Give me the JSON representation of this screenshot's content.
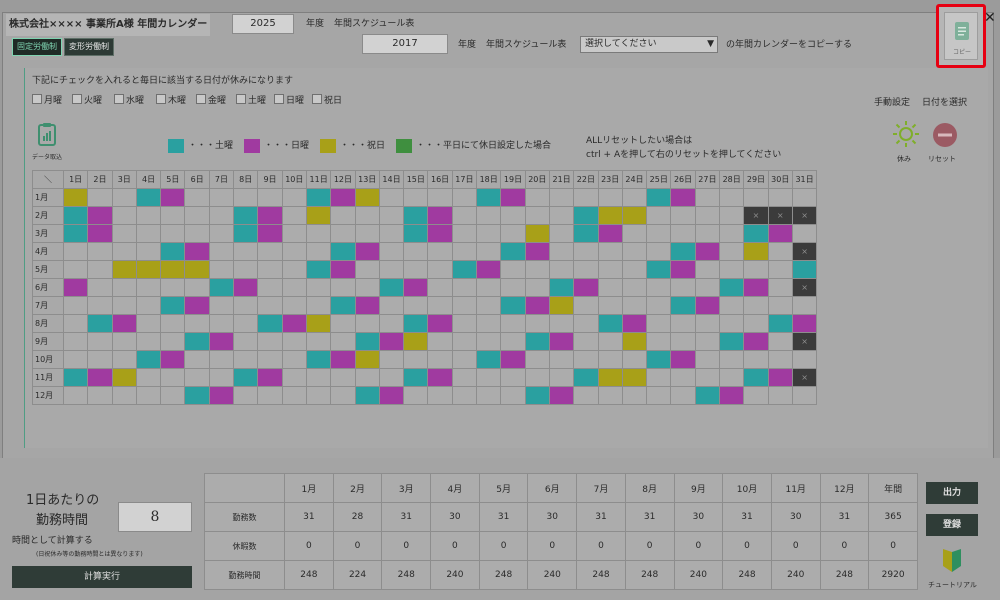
{
  "header": {
    "title": "株式会社×××× 事業所A様 年間カレンダー",
    "year1": "2025",
    "year_label1": "年度",
    "schedule_label1": "年間スケジュール表",
    "year2": "2017",
    "year_label2": "年度",
    "schedule_label2": "年間スケジュール表",
    "select_value": "選択してください",
    "copy_suffix": "の年間カレンダーをコピーする",
    "copy_button_label": "コピー"
  },
  "mode_tabs": [
    "固定労働制",
    "変形労働制"
  ],
  "weekday_instruction": "下記にチェックを入れると毎日に該当する日付が休みになります",
  "weekday_checks": [
    "月曜",
    "火曜",
    "水曜",
    "木曜",
    "金曜",
    "土曜",
    "日曜",
    "祝日"
  ],
  "manual": {
    "manual_setting": "手動設定",
    "select_date": "日付を選択",
    "holiday": "休み",
    "reset": "リセット"
  },
  "data_import": "データ取込",
  "legend": [
    {
      "label": "・・・土曜",
      "color": "#2aa0a0"
    },
    {
      "label": "・・・日曜",
      "color": "#a03aa0"
    },
    {
      "label": "・・・祝日",
      "color": "#a8a018"
    },
    {
      "label": "・・・平日にて休日設定した場合",
      "color": "#3f8f3f"
    }
  ],
  "reset_note": {
    "line1": "ALLリセットしたい場合は",
    "line2": "ctrl + Aを押して右のリセットを押してください"
  },
  "calendar": {
    "corner": "＼",
    "days": [
      "1日",
      "2日",
      "3日",
      "4日",
      "5日",
      "6日",
      "7日",
      "8日",
      "9日",
      "10日",
      "11日",
      "12日",
      "13日",
      "14日",
      "15日",
      "16日",
      "17日",
      "18日",
      "19日",
      "20日",
      "21日",
      "22日",
      "23日",
      "24日",
      "25日",
      "26日",
      "27日",
      "28日",
      "29日",
      "30日",
      "31日"
    ],
    "months": [
      "1月",
      "2月",
      "3月",
      "4月",
      "5月",
      "6月",
      "7月",
      "8月",
      "9月",
      "10月",
      "11月",
      "12月"
    ],
    "dead_mark": "×",
    "colors": {
      "S": "#2aa0a0",
      "U": "#a03aa0",
      "H": "#a8a018",
      "N": "#acacac"
    },
    "rows": [
      "HNNSUNNNNNSUHNNNNSUNNNNNSUNNNNN",
      "SUNNNNNSUNHNNNSUNNNNNSHHNNNNXXX",
      "SUNNNNNSUNNNNNSUNNNHNSUNNNNNSUN",
      "NNNNSUNNNNNSUNNNNNSUNNNNNSUNHNX",
      "NNHHHHNNNNSUNNNNSUNNNNNNSUNNNNS",
      "UNNNNNSUNNNNNSUNNNNNSUNNNNNSUNX",
      "NNNNSUNNNNNSUNNNNNSUHNNNNSUNNNN",
      "NSUNNNNNSUHNNNSUNNNNNNSUNNNNNSU",
      "NNNNNSUNNNNNSUHNNNNSUNNHNNNSUNX",
      "NNNSUNNNNNSUHNNNNSUNNNNNSUNNNNN",
      "SUHNNNNSUNNNNNSUNNNNNSHHNNNNSUX",
      "NNNNNSUNNNNNSUNNNNNSUNNNNNSUNNN"
    ]
  },
  "bottom": {
    "per_day_title1": "1日あたりの",
    "per_day_title2": "勤務時間",
    "hours": "8",
    "calc_as": "時間として計算する",
    "calc_note": "(日祝休み等の勤務時間とは異なります)",
    "calc_button": "計算実行",
    "output_button": "出力",
    "register_button": "登録",
    "tutorial": "チュートリアル"
  },
  "summary": {
    "headers": [
      "1月",
      "2月",
      "3月",
      "4月",
      "5月",
      "6月",
      "7月",
      "8月",
      "9月",
      "10月",
      "11月",
      "12月",
      "年間"
    ],
    "rows": [
      {
        "label": "勤務数",
        "values": [
          "31",
          "28",
          "31",
          "30",
          "31",
          "30",
          "31",
          "31",
          "30",
          "31",
          "30",
          "31",
          "365"
        ]
      },
      {
        "label": "休暇数",
        "values": [
          "0",
          "0",
          "0",
          "0",
          "0",
          "0",
          "0",
          "0",
          "0",
          "0",
          "0",
          "0",
          "0"
        ]
      },
      {
        "label": "勤務時間",
        "values": [
          "248",
          "224",
          "248",
          "240",
          "248",
          "240",
          "248",
          "248",
          "240",
          "248",
          "240",
          "248",
          "2920"
        ]
      }
    ]
  }
}
